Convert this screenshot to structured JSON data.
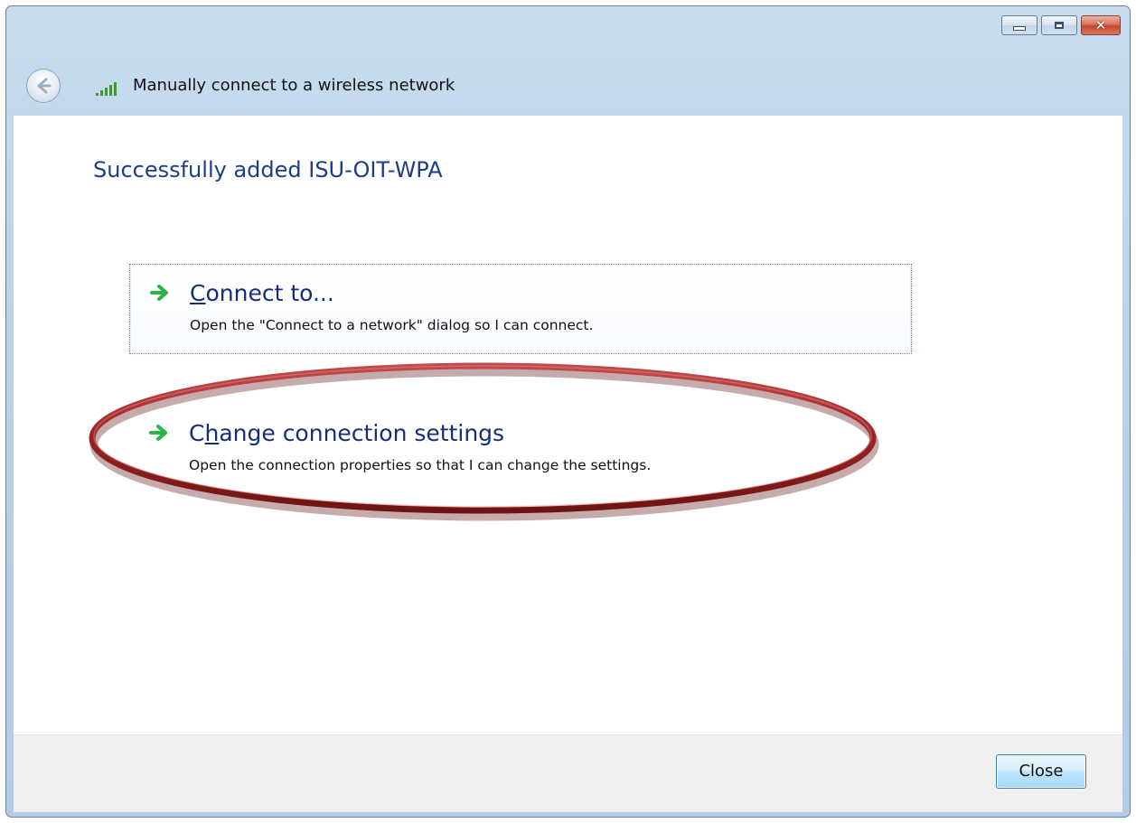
{
  "window": {
    "title": "Manually connect to a wireless network",
    "controls": {
      "minimize": "minimize",
      "maximize": "maximize",
      "close": "close"
    }
  },
  "content": {
    "heading": "Successfully added ISU-OIT-WPA",
    "options": [
      {
        "label": "Connect to...",
        "access_key": "C",
        "description": "Open the \"Connect to a network\" dialog so I can connect.",
        "icon": "green-arrow-icon",
        "focused": true
      },
      {
        "label": "Change connection settings",
        "access_key": "h",
        "description": "Open the connection properties so that I can change the settings.",
        "icon": "green-arrow-icon",
        "highlighted": true
      }
    ]
  },
  "footer": {
    "close_label": "Close"
  },
  "colors": {
    "heading": "#1e3d87",
    "link": "#152e78",
    "highlight_ellipse": "#a52a2a",
    "arrow": "#2bb34a"
  }
}
